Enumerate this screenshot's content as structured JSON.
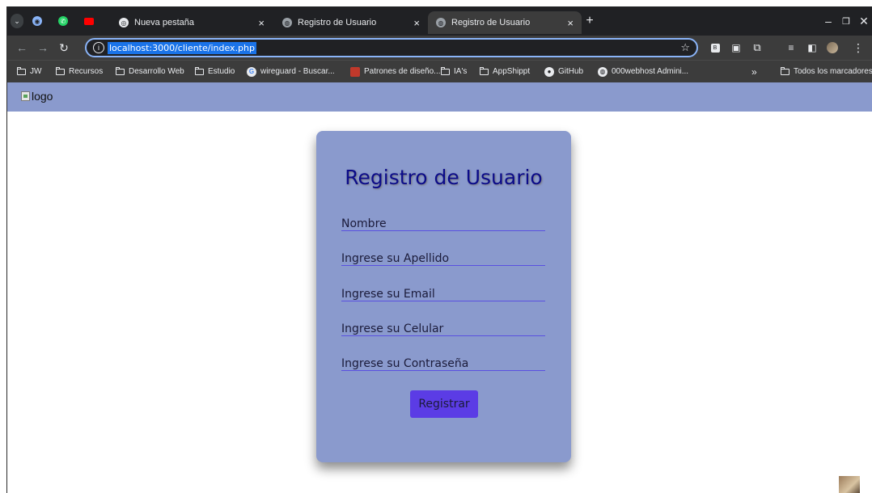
{
  "browser": {
    "tabs": [
      {
        "title": "Nueva pestaña",
        "active": false
      },
      {
        "title": "Registro de Usuario",
        "active": false
      },
      {
        "title": "Registro de Usuario",
        "active": true
      }
    ],
    "new_tab": "+",
    "address": "localhost:3000/cliente/index.php",
    "bookmarks": [
      {
        "label": "JW",
        "icon": "folder-icon"
      },
      {
        "label": "Recursos",
        "icon": "folder-icon"
      },
      {
        "label": "Desarrollo Web",
        "icon": "folder-icon"
      },
      {
        "label": "Estudio",
        "icon": "folder-icon"
      },
      {
        "label": "wireguard - Buscar...",
        "icon": "google-icon"
      },
      {
        "label": "Patrones de diseño...",
        "icon": "site-icon"
      },
      {
        "label": "IA's",
        "icon": "folder-icon"
      },
      {
        "label": "AppShippt",
        "icon": "folder-icon"
      },
      {
        "label": "GitHub",
        "icon": "github-icon"
      },
      {
        "label": "000webhost Admini...",
        "icon": "site-icon"
      }
    ],
    "more_bookmarks": "»",
    "all_bookmarks": "Todos los marcadores"
  },
  "page": {
    "logo_alt": "logo",
    "form": {
      "title": "Registro de Usuario",
      "fields": [
        {
          "placeholder": "Nombre"
        },
        {
          "placeholder": "Ingrese su Apellido"
        },
        {
          "placeholder": "Ingrese su Email"
        },
        {
          "placeholder": "Ingrese su Celular"
        },
        {
          "placeholder": "Ingrese su Contraseña"
        }
      ],
      "submit": "Registrar"
    }
  },
  "colors": {
    "header_bg": "#8a9acd",
    "card_bg": "#8a9acd",
    "title_color": "#0b0b8a",
    "button_bg": "#5b3ce5",
    "chrome_dark": "#202124",
    "chrome_toolbar": "#3c3c3c"
  }
}
